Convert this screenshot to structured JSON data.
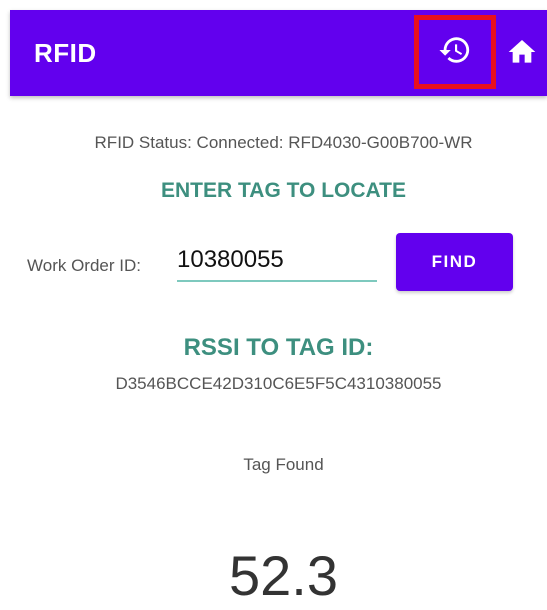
{
  "appbar": {
    "title": "RFID",
    "background": "#6200ee",
    "history_icon": "history-icon",
    "home_icon": "home-icon",
    "highlight_color": "#e8101c"
  },
  "status": {
    "text": "RFID Status:  Connected: RFD4030-G00B700-WR"
  },
  "locate": {
    "heading": "ENTER TAG TO LOCATE",
    "work_order_label": "Work Order ID:",
    "work_order_value": "10380055",
    "find_label": "FIND"
  },
  "rssi": {
    "heading": "RSSI TO TAG ID:",
    "tag_id": "D3546BCCE42D310C6E5F5C4310380055",
    "status_text": "Tag Found",
    "value": "52.3"
  },
  "colors": {
    "accent": "#6200ee",
    "heading_teal": "#3d8f7f",
    "underline": "#7ec9be"
  }
}
